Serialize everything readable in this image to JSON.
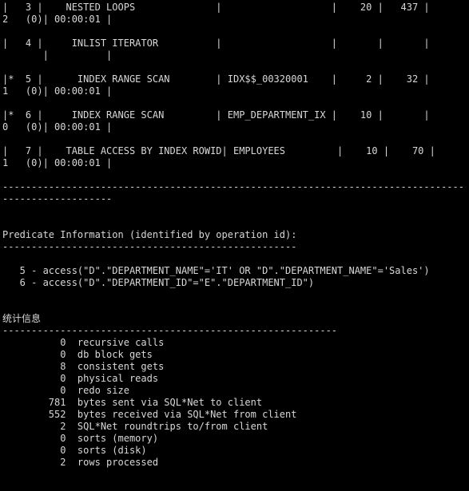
{
  "terminal": {
    "lines": [
      "|   3 |    NESTED LOOPS              |                   |    20 |   437 |",
      "2   (0)| 00:00:01 |",
      "",
      "|   4 |     INLIST ITERATOR          |                   |       |       |",
      "       |          |",
      "",
      "|*  5 |      INDEX RANGE SCAN        | IDX$$_00320001    |     2 |    32 |",
      "1   (0)| 00:00:01 |",
      "",
      "|*  6 |     INDEX RANGE SCAN         | EMP_DEPARTMENT_IX |    10 |       |",
      "0   (0)| 00:00:01 |",
      "",
      "|   7 |    TABLE ACCESS BY INDEX ROWID| EMPLOYEES         |    10 |    70 |",
      "1   (0)| 00:00:01 |",
      "",
      "--------------------------------------------------------------------------------",
      "-------------------",
      "",
      "",
      "Predicate Information (identified by operation id):",
      "---------------------------------------------------",
      "",
      "   5 - access(\"D\".\"DEPARTMENT_NAME\"='IT' OR \"D\".\"DEPARTMENT_NAME\"='Sales')",
      "   6 - access(\"D\".\"DEPARTMENT_ID\"=\"E\".\"DEPARTMENT_ID\")",
      "",
      "",
      "统计信息",
      "----------------------------------------------------------",
      "          0  recursive calls",
      "          0  db block gets",
      "          8  consistent gets",
      "          0  physical reads",
      "          0  redo size",
      "        781  bytes sent via SQL*Net to client",
      "        552  bytes received via SQL*Net from client",
      "          2  SQL*Net roundtrips to/from client",
      "          0  sorts (memory)",
      "          0  sorts (disk)",
      "          2  rows processed",
      ""
    ]
  }
}
